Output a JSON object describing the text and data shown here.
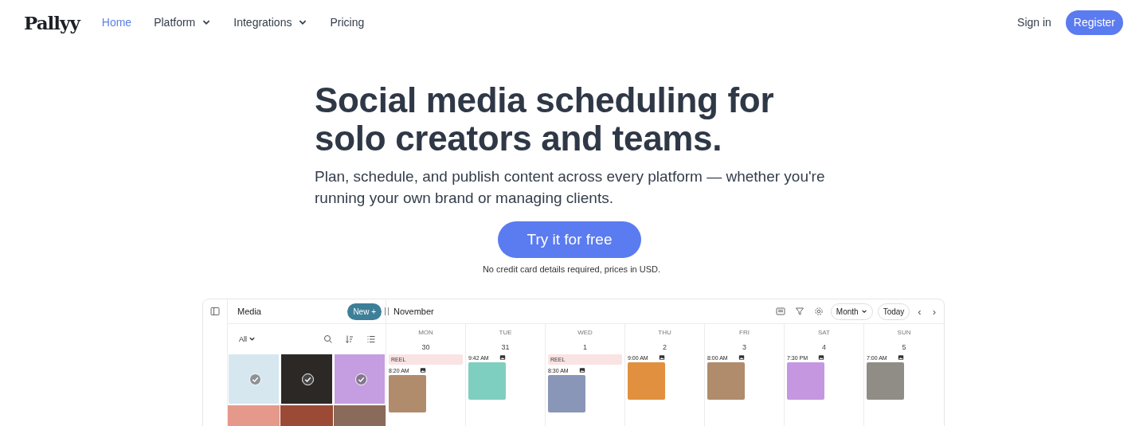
{
  "nav": {
    "logo": "Pallyy",
    "links": [
      {
        "label": "Home",
        "selected": true,
        "dropdown": false
      },
      {
        "label": "Platform",
        "selected": false,
        "dropdown": true
      },
      {
        "label": "Integrations",
        "selected": false,
        "dropdown": true
      },
      {
        "label": "Pricing",
        "selected": false,
        "dropdown": false
      }
    ],
    "sign_in": "Sign in",
    "register": "Register"
  },
  "hero": {
    "title": "Social media scheduling for solo creators and teams.",
    "subtitle": "Plan, schedule, and publish content across every platform — whether you're running your own brand or managing clients.",
    "cta": "Try it for free",
    "note": "No credit card details required, prices in USD."
  },
  "app": {
    "media": {
      "title": "Media",
      "new_button": "New +",
      "filter": "All",
      "tiles": [
        {
          "checked": true
        },
        {
          "checked": true
        },
        {
          "checked": true
        },
        {
          "checked": false
        },
        {
          "checked": false
        },
        {
          "checked": false
        }
      ]
    },
    "calendar": {
      "month": "November",
      "view": "Month",
      "today": "Today",
      "prev": "‹",
      "next": "›",
      "days": [
        {
          "name": "MON",
          "date": "30",
          "events": [
            {
              "kind": "label",
              "text": "REEL"
            },
            {
              "kind": "post",
              "time": "8:20 AM"
            }
          ]
        },
        {
          "name": "TUE",
          "date": "31",
          "events": [
            {
              "kind": "post",
              "time": "9:42 AM"
            }
          ]
        },
        {
          "name": "WED",
          "date": "1",
          "events": [
            {
              "kind": "label",
              "text": "REEL"
            },
            {
              "kind": "post",
              "time": "8:30 AM"
            }
          ]
        },
        {
          "name": "THU",
          "date": "2",
          "events": [
            {
              "kind": "post",
              "time": "9:00 AM"
            }
          ]
        },
        {
          "name": "FRI",
          "date": "3",
          "events": [
            {
              "kind": "post",
              "time": "8:00 AM"
            }
          ]
        },
        {
          "name": "SAT",
          "date": "4",
          "events": [
            {
              "kind": "post",
              "time": "7:30 PM"
            }
          ]
        },
        {
          "name": "SUN",
          "date": "5",
          "events": [
            {
              "kind": "post",
              "time": "7:00 AM"
            }
          ]
        }
      ]
    }
  }
}
